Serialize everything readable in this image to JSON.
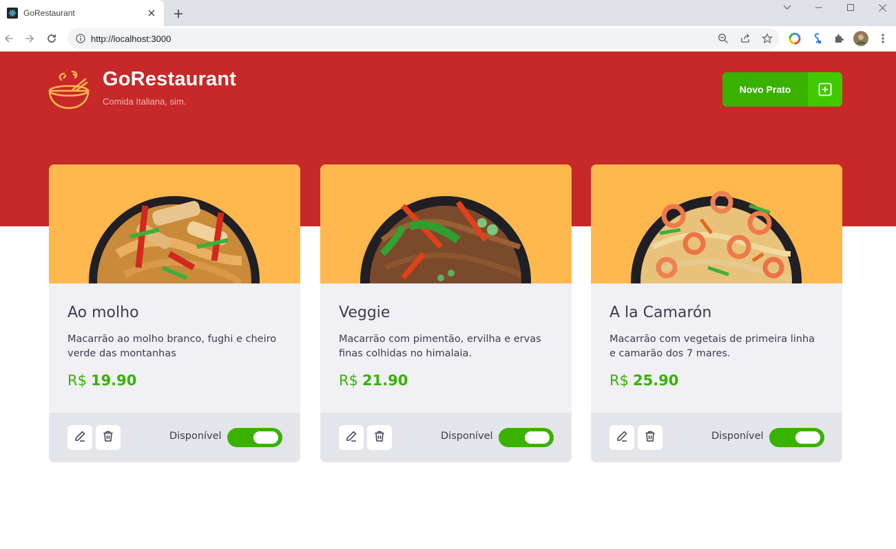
{
  "browser": {
    "tab_title": "GoRestaurant",
    "url": "http://localhost:3000"
  },
  "header": {
    "title": "GoRestaurant",
    "subtitle": "Comida Italiana, sim.",
    "new_button_label": "Novo Prato"
  },
  "colors": {
    "header_bg": "#c72828",
    "card_img_bg": "#ffb84d",
    "accent_green": "#39b100"
  },
  "dishes": [
    {
      "name": "Ao molho",
      "description": "Macarrão ao molho branco, fughi e cheiro verde das montanhas",
      "currency": "R$",
      "price": "19.90",
      "availability_label": "Disponível",
      "available": true
    },
    {
      "name": "Veggie",
      "description": "Macarrão com pimentão, ervilha e ervas finas colhidas no himalaia.",
      "currency": "R$",
      "price": "21.90",
      "availability_label": "Disponível",
      "available": true
    },
    {
      "name": "A la Camarón",
      "description": "Macarrão com vegetais de primeira linha e camarão dos 7 mares.",
      "currency": "R$",
      "price": "25.90",
      "availability_label": "Disponível",
      "available": true
    }
  ]
}
